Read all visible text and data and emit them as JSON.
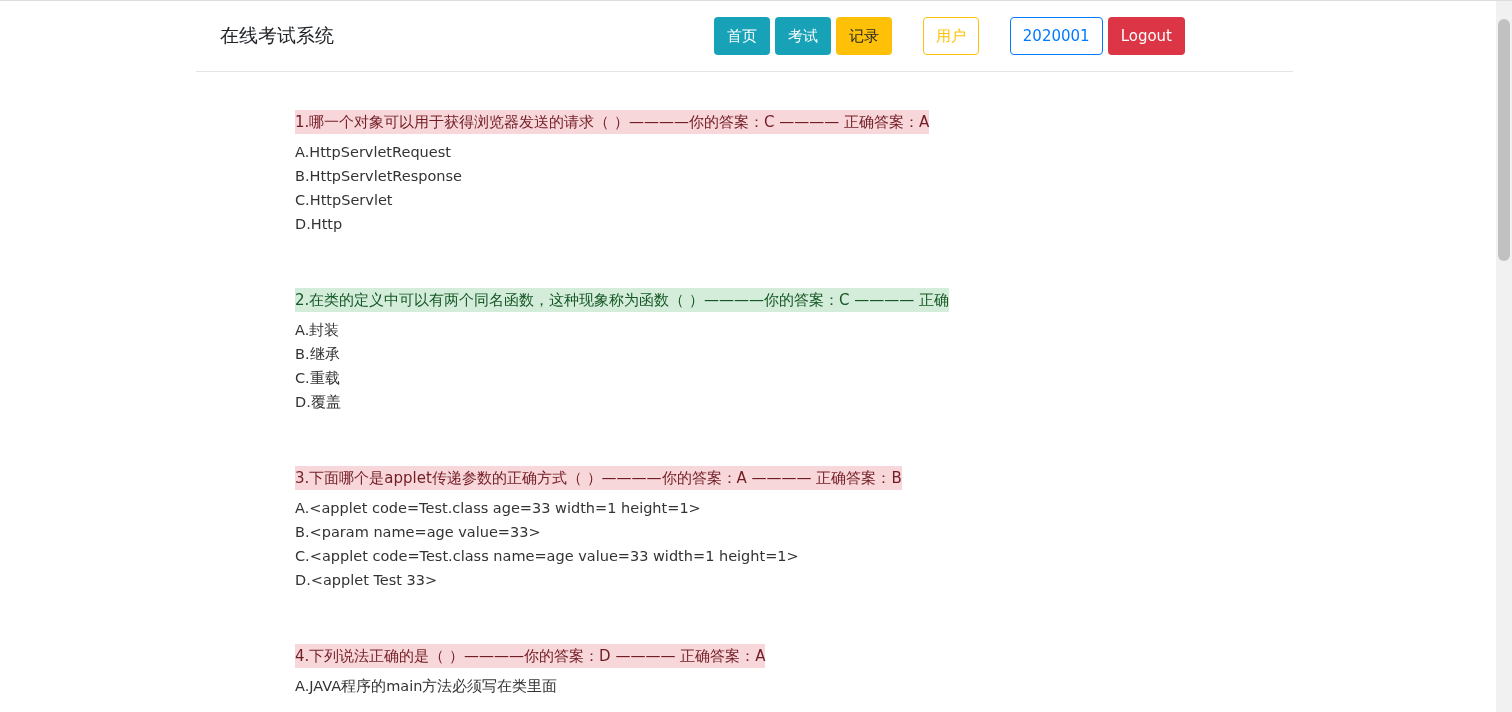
{
  "navbar": {
    "brand": "在线考试系统",
    "buttons": [
      {
        "label": "首页",
        "kind": "info"
      },
      {
        "label": "考试",
        "kind": "info"
      },
      {
        "label": "记录",
        "kind": "warning"
      },
      {
        "label": "用户",
        "kind": "outline-warning"
      },
      {
        "label": "2020001",
        "kind": "outline-primary"
      },
      {
        "label": "Logout",
        "kind": "danger"
      }
    ]
  },
  "questions": [
    {
      "header": "1.哪一个对象可以用于获得浏览器发送的请求（ ）————你的答案：C ———— 正确答案：A",
      "correct": false,
      "options": [
        "A.HttpServletRequest",
        "B.HttpServletResponse",
        "C.HttpServlet",
        "D.Http"
      ]
    },
    {
      "header": "2.在类的定义中可以有两个同名函数，这种现象称为函数（ ）————你的答案：C ———— 正确",
      "correct": true,
      "options": [
        "A.封装",
        "B.继承",
        "C.重载",
        "D.覆盖"
      ]
    },
    {
      "header": "3.下面哪个是applet传递参数的正确方式（ ）————你的答案：A ———— 正确答案：B",
      "correct": false,
      "options": [
        "A.<applet code=Test.class age=33 width=1 height=1>",
        "B.<param name=age value=33>",
        "C.<applet code=Test.class name=age value=33 width=1 height=1>",
        "D.<applet Test 33>"
      ]
    },
    {
      "header": "4.下列说法正确的是（ ）————你的答案：D ———— 正确答案：A",
      "correct": false,
      "options": [
        "A.JAVA程序的main方法必须写在类里面"
      ]
    }
  ]
}
